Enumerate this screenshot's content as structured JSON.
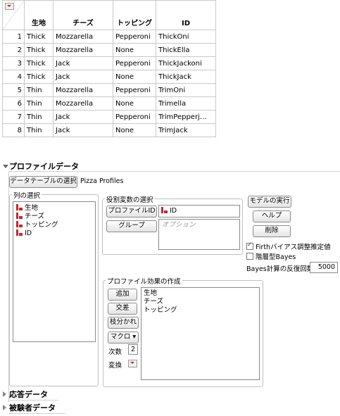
{
  "table": {
    "columns": [
      "生地",
      "チーズ",
      "トッピング",
      "ID"
    ],
    "rows": [
      [
        "1",
        "Thick",
        "Mozzarella",
        "Pepperoni",
        "ThickOni"
      ],
      [
        "2",
        "Thick",
        "Mozzarella",
        "None",
        "ThickElla"
      ],
      [
        "3",
        "Thick",
        "Jack",
        "Pepperoni",
        "ThickJackoni"
      ],
      [
        "4",
        "Thick",
        "Jack",
        "None",
        "ThickJack"
      ],
      [
        "5",
        "Thin",
        "Mozzarella",
        "Pepperoni",
        "TrimOni"
      ],
      [
        "6",
        "Thin",
        "Mozzarella",
        "None",
        "Trimella"
      ],
      [
        "7",
        "Thin",
        "Jack",
        "Pepperoni",
        "TrimPepperj…"
      ],
      [
        "8",
        "Thin",
        "Jack",
        "None",
        "TrimJack"
      ]
    ]
  },
  "panel": {
    "title": "プロファイルデータ",
    "select_table_button": "データテーブルの選択",
    "table_name": "Pizza Profiles",
    "columns_group": "列の選択",
    "columns": [
      "生地",
      "チーズ",
      "トッピング",
      "ID"
    ],
    "roles_group": "役割変数の選択",
    "profile_id_button": "プロファイルID",
    "profile_id_value": "ID",
    "group_button": "グループ",
    "group_placeholder": "オプション",
    "run_button": "モデルの実行",
    "help_button": "ヘルプ",
    "remove_button": "削除",
    "firth_label": "Firthバイアス調整推定値",
    "firth_checked": true,
    "bayes_label": "階層型Bayes",
    "bayes_checked": false,
    "iterations_label": "Bayes計算の反復回数",
    "iterations_value": "5000",
    "effects_group": "プロファイル効果の作成",
    "add_button": "追加",
    "cross_button": "交差",
    "nest_button": "枝分かれ",
    "macro_button": "マクロ ▾",
    "degree_label": "次数",
    "degree_value": "2",
    "transform_label": "変換",
    "effects": [
      "生地",
      "チーズ",
      "トッピング"
    ]
  },
  "sections": {
    "response_data": "応答データ",
    "subject_data": "被験者データ"
  },
  "colors": {
    "column_icon": "#c0282d",
    "corner_arrow": "#cc2222"
  }
}
